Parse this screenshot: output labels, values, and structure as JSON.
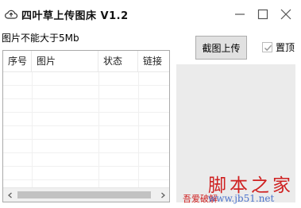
{
  "window": {
    "title": "四叶草上传图床 V1.2",
    "icons": {
      "app": "cloud-upload-icon",
      "minimize": "minimize-icon",
      "maximize": "maximize-icon",
      "close": "close-icon"
    }
  },
  "notice": "图片不能大于5Mb",
  "table": {
    "columns": [
      "序号",
      "图片",
      "状态",
      "链接"
    ],
    "rows": []
  },
  "upload_button": "截图上传",
  "pin": {
    "label": "置顶",
    "checked": true
  },
  "watermark": {
    "logo": "脚本之家",
    "sub": "吾爱破解",
    "url": "www.jb51.net"
  },
  "colors": {
    "watermark_red": "#cf2020",
    "preview_bg": "#ebebeb"
  }
}
